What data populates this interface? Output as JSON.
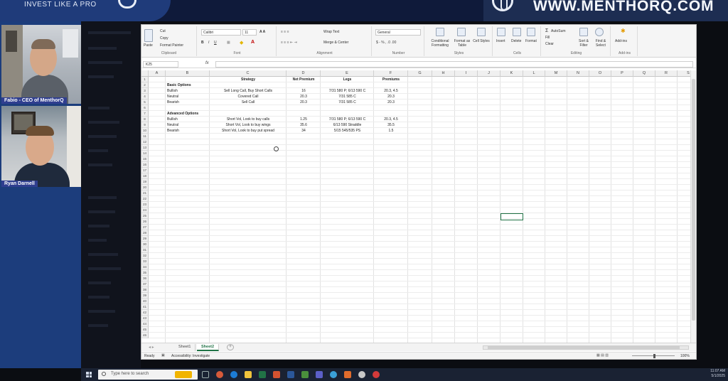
{
  "banner": {
    "tagline": "INVEST LIKE A PRO",
    "site_url": "WWW.MENTHORQ.COM"
  },
  "participants": [
    {
      "name": "Fabio - CEO of MenthorQ"
    },
    {
      "name": "Ryan Darnell"
    }
  ],
  "ribbon": {
    "clipboard": {
      "label": "Clipboard",
      "cut": "Cut",
      "copy": "Copy",
      "format_painter": "Format Painter",
      "paste": "Paste"
    },
    "font": {
      "label": "Font",
      "font_name": "Calibri",
      "font_size": "11"
    },
    "alignment": {
      "label": "Alignment",
      "wrap_text": "Wrap Text",
      "merge_center": "Merge & Center"
    },
    "number": {
      "label": "Number",
      "format": "General"
    },
    "styles": {
      "label": "Styles",
      "conditional": "Conditional Formatting",
      "format_as_table": "Format as Table",
      "cell_styles": "Cell Styles"
    },
    "cells": {
      "label": "Cells",
      "insert": "Insert",
      "delete": "Delete",
      "format": "Format"
    },
    "editing": {
      "label": "Editing",
      "autosum": "AutoSum",
      "fill": "Fill",
      "clear": "Clear",
      "sort_filter": "Sort & Filter",
      "find_select": "Find & Select"
    },
    "addins": {
      "label": "Add-ins",
      "addins": "Add-ins"
    }
  },
  "formula_bar": {
    "name_box": "K25",
    "fx": "fx"
  },
  "columns": [
    "A",
    "B",
    "C",
    "D",
    "E",
    "F",
    "G",
    "H",
    "I",
    "J",
    "K",
    "L",
    "M",
    "N",
    "O",
    "P",
    "Q",
    "R",
    "S"
  ],
  "sheet": {
    "headers": {
      "strategy": "Strategy",
      "net_premium": "Net Premium",
      "legs": "Legs",
      "premiums": "Premiums"
    },
    "basic_title": "Basic Options",
    "basic_rows": [
      {
        "label": "Bullish",
        "strategy": "Sell Long Call, Buy Short Calls",
        "net": "16",
        "legs": "7/31 580 P; 6/13 590 C",
        "prem": "20.3, 4.5"
      },
      {
        "label": "Neutral",
        "strategy": "Covered Call",
        "net": "20.3",
        "legs": "7/31 585 C",
        "prem": "20.3"
      },
      {
        "label": "Bearish",
        "strategy": "Sell Call",
        "net": "20.3",
        "legs": "7/31 585 C",
        "prem": "20.3"
      }
    ],
    "advanced_title": "Advanced Options",
    "advanced_rows": [
      {
        "label": "Bullish",
        "strategy": "Short Vol, Look to buy calls",
        "net": "1.25",
        "legs": "7/31 580 P; 6/13 590 C",
        "prem": "20.3, 4.5"
      },
      {
        "label": "Neutral",
        "strategy": "Short Vol, Look to buy wings",
        "net": "35.6",
        "legs": "6/13 590 Straddle",
        "prem": "35.5"
      },
      {
        "label": "Bearish",
        "strategy": "Short Vol, Look to buy put spread",
        "net": "34",
        "legs": "5/15 545/535 PS",
        "prem": "1.5"
      }
    ]
  },
  "tabs": [
    "Sheet1",
    "Sheet2"
  ],
  "active_tab": "Sheet2",
  "status": {
    "ready": "Ready",
    "accessibility": "Accessibility: Investigate",
    "zoom": "100%"
  },
  "taskbar": {
    "search_placeholder": "Type here to search",
    "time": "11:07 AM",
    "date": "5/1/2025"
  },
  "colors": {
    "excel_green": "#217346",
    "banner_blue": "#1f3b7a"
  }
}
